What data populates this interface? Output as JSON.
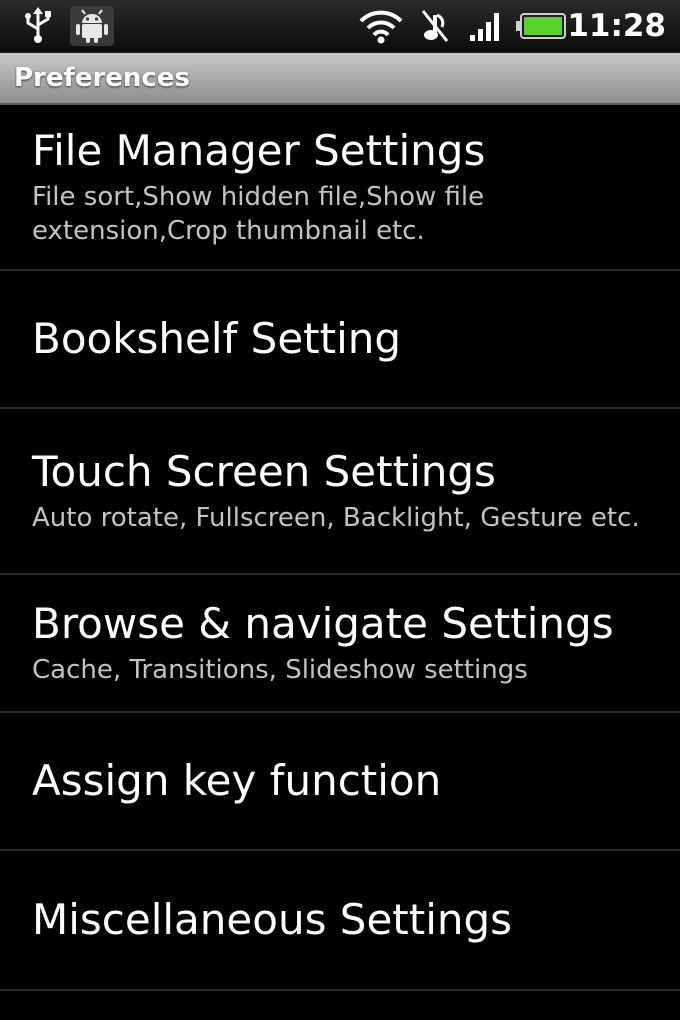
{
  "status_bar": {
    "time": "11:28",
    "icons": [
      "usb-icon",
      "android-icon",
      "wifi-icon",
      "ringer-off-icon",
      "signal-icon",
      "battery-icon"
    ],
    "battery_color": "#5cd22f"
  },
  "title_bar": {
    "title": "Preferences"
  },
  "settings": [
    {
      "label": "File Manager Settings",
      "summary": "File sort,Show hidden file,Show file extension,Crop thumbnail etc."
    },
    {
      "label": "Bookshelf Setting",
      "summary": ""
    },
    {
      "label": "Touch Screen Settings",
      "summary": "Auto rotate, Fullscreen, Backlight, Gesture etc."
    },
    {
      "label": "Browse & navigate Settings",
      "summary": "Cache, Transitions, Slideshow settings"
    },
    {
      "label": "Assign key function",
      "summary": ""
    },
    {
      "label": "Miscellaneous Settings",
      "summary": ""
    }
  ]
}
